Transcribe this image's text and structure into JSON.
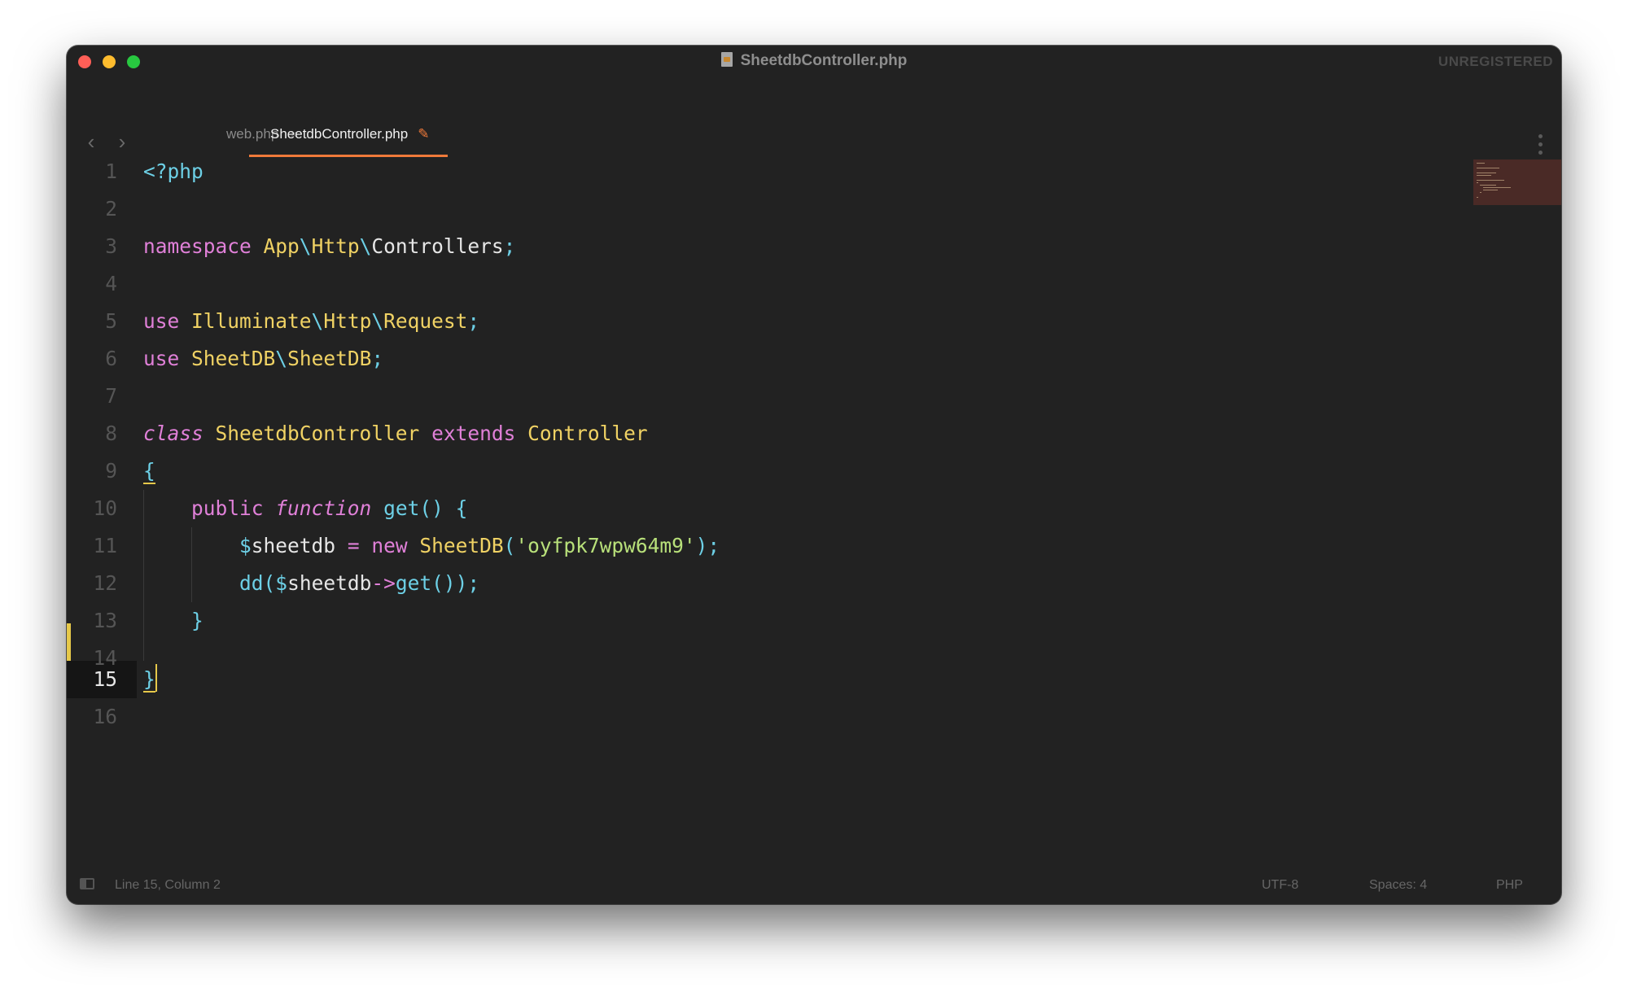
{
  "window": {
    "title": "SheetdbController.php",
    "unregistered": "UNREGISTERED"
  },
  "tabs": [
    {
      "label": "web.php",
      "close": "×"
    },
    {
      "label": "SheetdbController.php",
      "modified_icon": "pencil-icon"
    }
  ],
  "editor": {
    "line_numbers": [
      "1",
      "2",
      "3",
      "4",
      "5",
      "6",
      "7",
      "8",
      "9",
      "10",
      "11",
      "12",
      "13",
      "14",
      "15",
      "16"
    ],
    "current_line": 15,
    "lines": [
      "<?php",
      "",
      "namespace App\\Http\\Controllers;",
      "",
      "use Illuminate\\Http\\Request;",
      "use SheetDB\\SheetDB;",
      "",
      "class SheetdbController extends Controller",
      "{",
      "    public function get() {",
      "        $sheetdb = new SheetDB('oyfpk7wpw64m9');",
      "        dd($sheetdb->get());",
      "    }",
      "",
      "}",
      ""
    ]
  },
  "colors": {
    "background": "#222222",
    "keyword": "#e080d8",
    "type": "#f0d264",
    "punctuation": "#6dd0e6",
    "string": "#b8e07a",
    "accent": "#f07a3a",
    "caret": "#e6c84a"
  },
  "status": {
    "position": "Line 15, Column 2",
    "encoding": "UTF-8",
    "indentation": "Spaces: 4",
    "syntax": "PHP"
  }
}
